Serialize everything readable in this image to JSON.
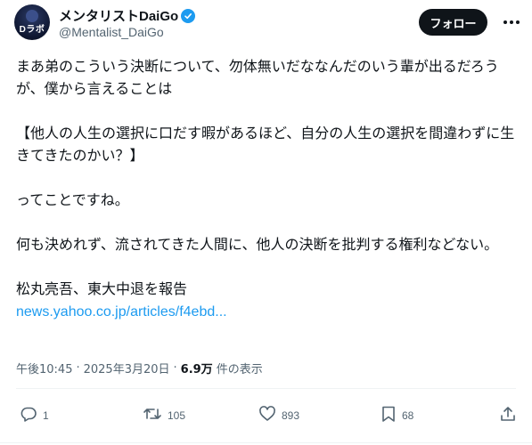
{
  "author": {
    "display_name": "メンタリストDaiGo",
    "handle": "@Mentalist_DaiGo",
    "avatar_text": "Dラボ",
    "verified": true
  },
  "header": {
    "follow_label": "フォロー",
    "more_icon": "more-horizontal-icon"
  },
  "tweet": {
    "line1": "まあ弟のこういう決断について、勿体無いだななんだのいう輩が出るだろうが、僕から言えることは",
    "line2": "【他人の人生の選択に口だす暇があるほど、自分の人生の選択を間違わずに生きてきたのかい？】",
    "line3": "ってことですね。",
    "line4": "何も決めれず、流されてきた人間に、他人の決断を批判する権利などない。",
    "line5": "松丸亮吾、東大中退を報告",
    "link": "news.yahoo.co.jp/articles/f4ebd..."
  },
  "meta": {
    "time": "午後10:45",
    "separator": "·",
    "date": "2025年3月20日",
    "views_count": "6.9万",
    "views_label": "件の表示"
  },
  "actions": {
    "reply_count": "1",
    "repost_count": "105",
    "like_count": "893",
    "bookmark_count": "68"
  },
  "colors": {
    "text": "#0f1419",
    "secondary": "#536471",
    "accent": "#1d9bf0",
    "button_bg": "#0f1419"
  }
}
